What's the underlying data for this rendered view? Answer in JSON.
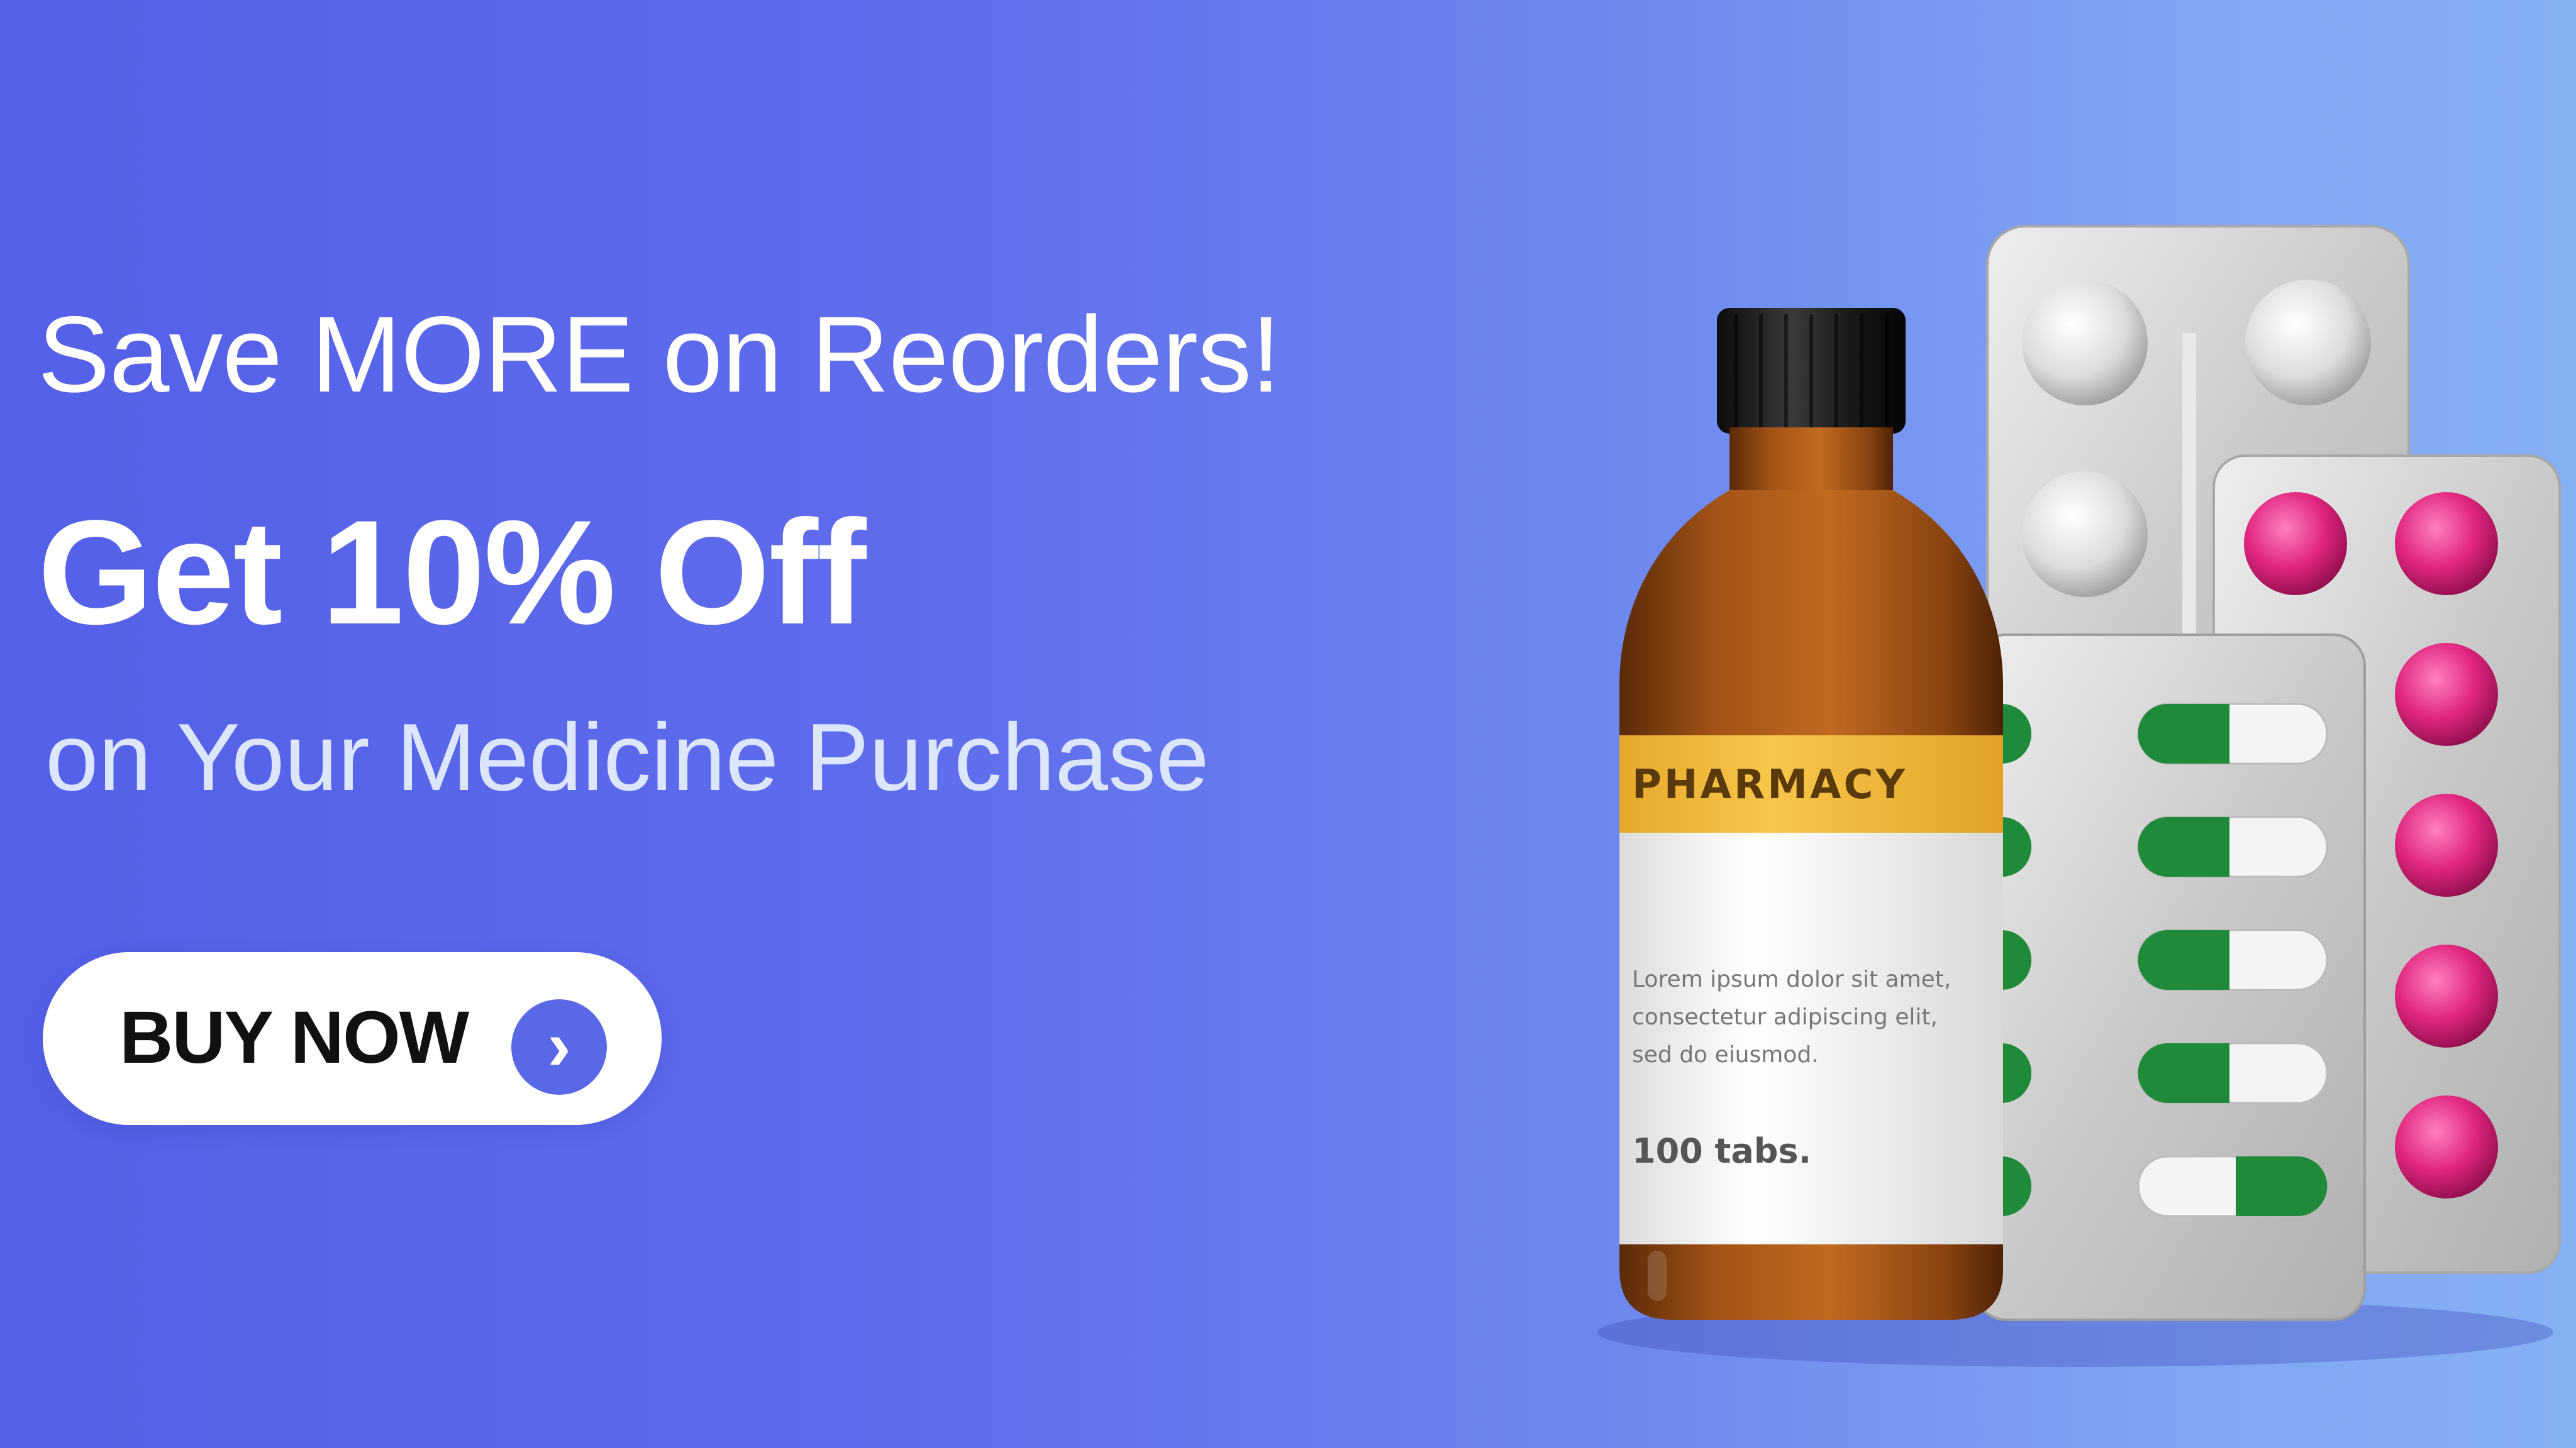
{
  "banner": {
    "headline": "Save MORE on Reorders!",
    "offer": "Get 10% Off",
    "subline": "on Your Medicine Purchase",
    "cta_label": "BUY NOW",
    "cta_icon": "chevron-right-icon",
    "colors": {
      "background_start": "#5360e8",
      "background_end": "#86b0f4",
      "button_bg": "#ffffff",
      "button_text": "#111111",
      "arrow_circle": "#5868e6"
    }
  },
  "product": {
    "bottle_label_brand": "PHARMACY",
    "bottle_label_text_lines": [
      "Lorem ipsum dolor sit amet,",
      "consectetur adipiscing elit,",
      "sed do eiusmod."
    ],
    "bottle_label_count": "100 tabs."
  }
}
